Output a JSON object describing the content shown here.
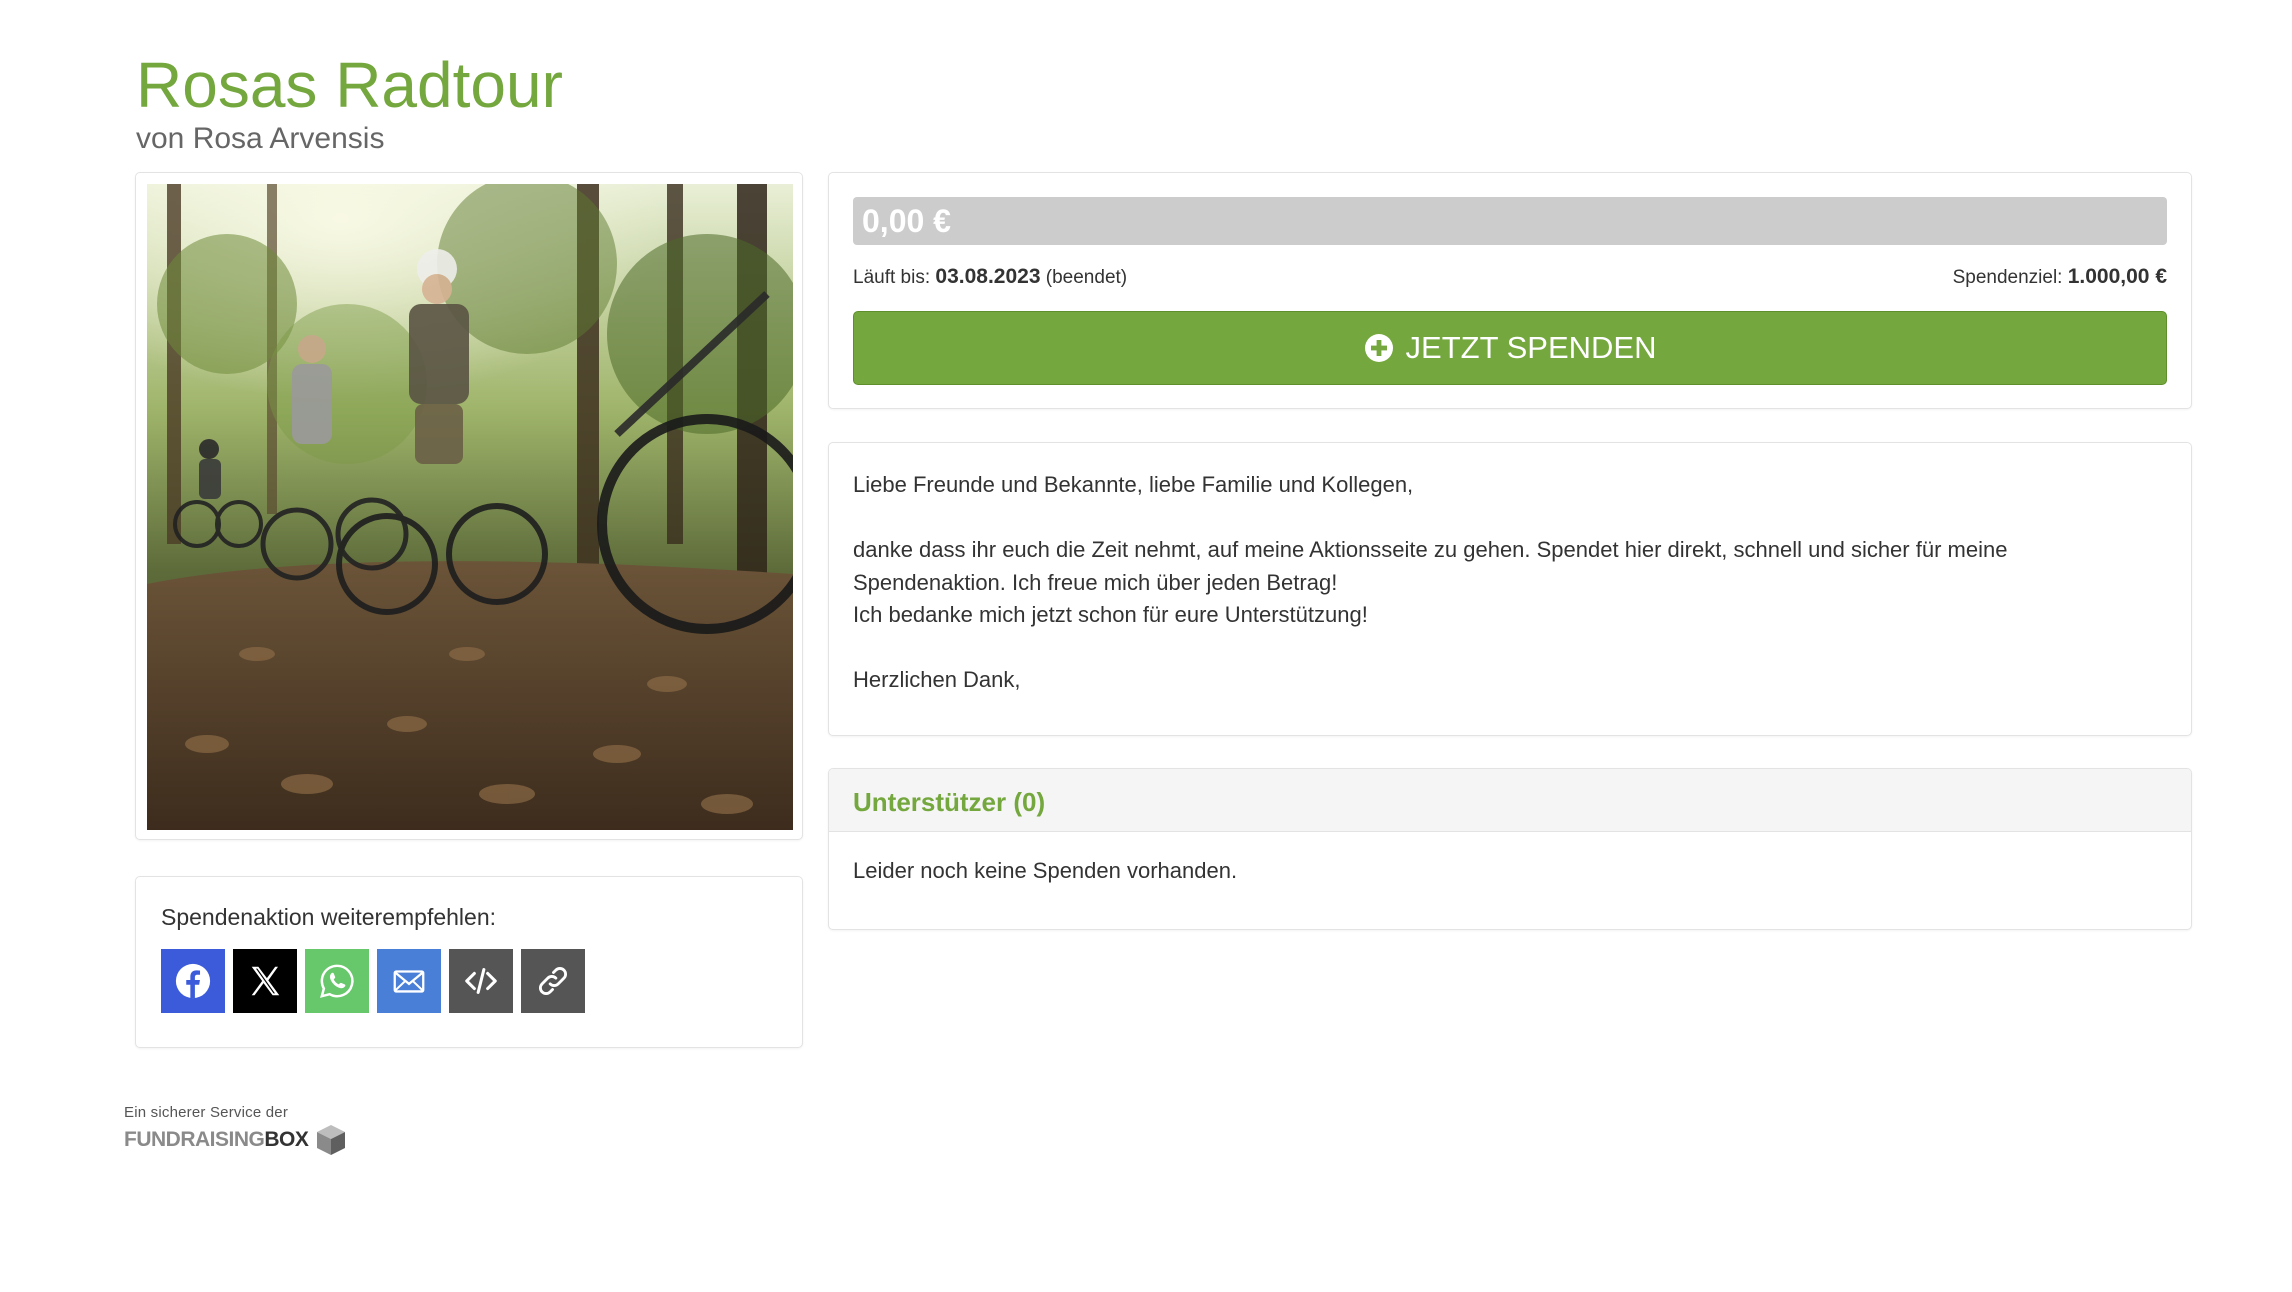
{
  "campaign": {
    "title": "Rosas Radtour",
    "author": "von Rosa Arvensis"
  },
  "image": {
    "description": "Gruppe von Radfahrern auf einem Waldweg"
  },
  "share": {
    "label": "Spendenaktion weiterempfehlen:",
    "buttons": [
      {
        "name": "facebook",
        "icon": "facebook-icon",
        "color": "#3b5bdb"
      },
      {
        "name": "x",
        "icon": "x-icon",
        "color": "#000000"
      },
      {
        "name": "whatsapp",
        "icon": "whatsapp-icon",
        "color": "#67c76b"
      },
      {
        "name": "email",
        "icon": "mail-icon",
        "color": "#4a7fd8"
      },
      {
        "name": "embed",
        "icon": "code-icon",
        "color": "#555555"
      },
      {
        "name": "link",
        "icon": "link-icon",
        "color": "#555555"
      }
    ]
  },
  "donation": {
    "amount": "0,00 €",
    "progress_percent": 0,
    "runs_until_label": "Läuft bis:",
    "end_date": "03.08.2023",
    "status": "(beendet)",
    "goal_label": "Spendenziel:",
    "goal_amount": "1.000,00 €",
    "button_label": "JETZT SPENDEN"
  },
  "description": {
    "greeting": "Liebe Freunde und Bekannte, liebe Familie und Kollegen,",
    "line1": "danke dass ihr euch die Zeit nehmt, auf meine Aktionsseite zu gehen. Spendet hier direkt, schnell und sicher für meine",
    "line2": "Spendenaktion. Ich freue mich über jeden Betrag!",
    "line3": "Ich bedanke mich jetzt schon für eure Unterstützung!",
    "closing": "Herzlichen Dank,"
  },
  "supporters": {
    "heading": "Unterstützer (0)",
    "empty_text": "Leider noch keine Spenden vorhanden."
  },
  "footer": {
    "tagline": "Ein sicherer Service der",
    "brand_light": "FUNDRAISING",
    "brand_bold": "BOX"
  },
  "colors": {
    "accent": "#74a73d",
    "progress_bg": "#cccccc"
  }
}
